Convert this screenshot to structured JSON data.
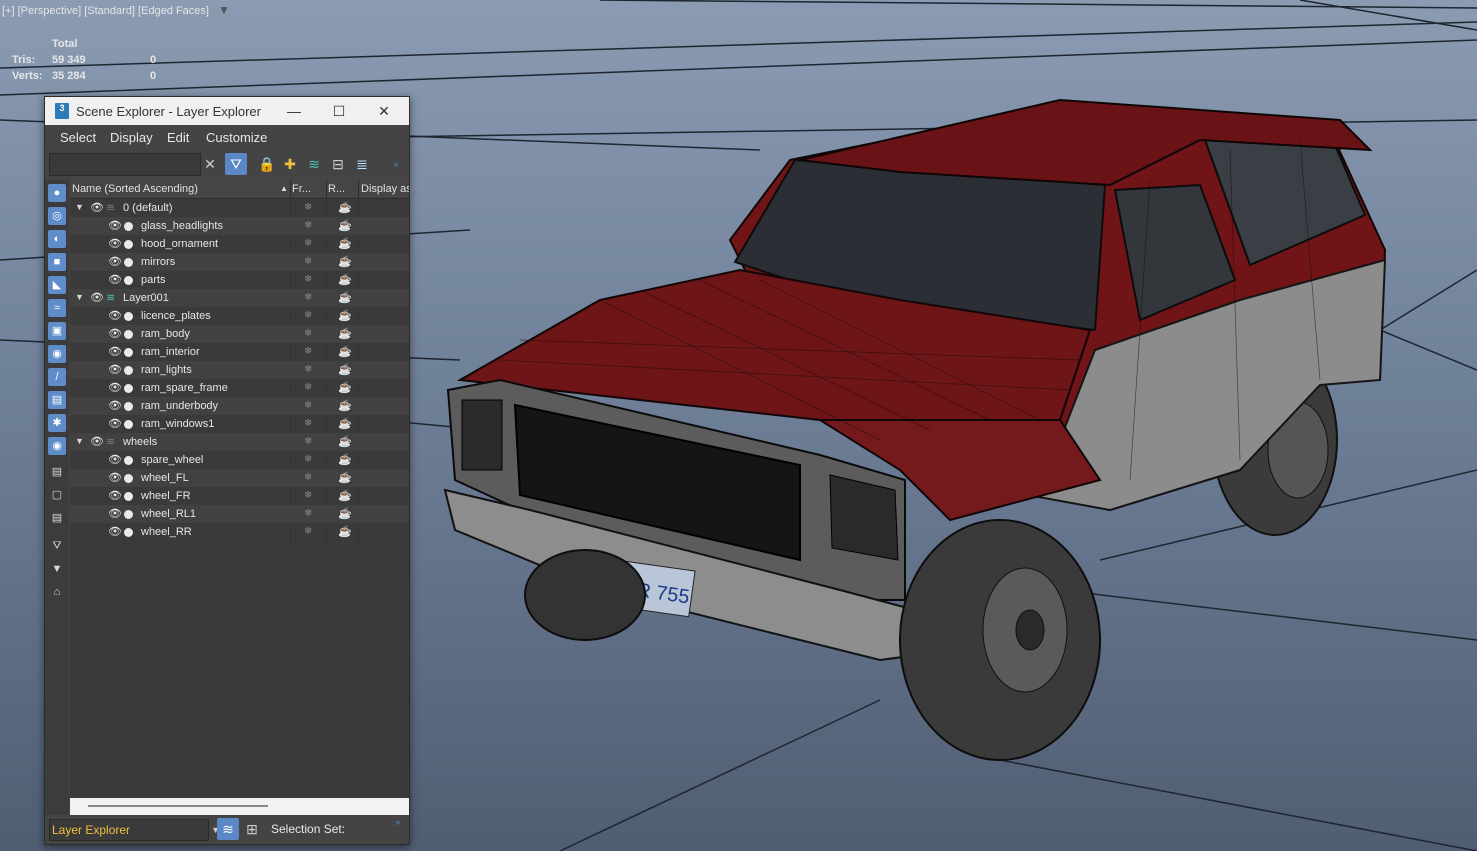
{
  "viewport": {
    "label": "[+] [Perspective] [Standard] [Edged Faces]",
    "filter_icon": "funnel-icon",
    "stats": {
      "header": "Total",
      "rows": [
        {
          "key": "Tris:",
          "total": "59 349",
          "selected": "0"
        },
        {
          "key": "Verts:",
          "total": "35 284",
          "selected": "0"
        }
      ]
    },
    "plate_text": "YYR 755",
    "colors": {
      "body_red": "#6b1416",
      "body_grey": "#8b8b8b",
      "tire": "#3a3a3a",
      "grid": "#1f2730"
    }
  },
  "explorer": {
    "title": "Scene Explorer - Layer Explorer",
    "app_icon": "3ds-max-icon",
    "menu": [
      "Select",
      "Display",
      "Edit",
      "Customize"
    ],
    "search_placeholder": "",
    "toolbar_icons": [
      "clear-icon",
      "filter-select-icon",
      "lock-icon",
      "new-layer-icon",
      "layer-stack-icon",
      "hierarchy-icon",
      "layers-icon"
    ],
    "columns": [
      "Name (Sorted Ascending)",
      "Fr...",
      "R...",
      "Display as"
    ],
    "rows": [
      {
        "level": 0,
        "name": "0 (default)",
        "expanded": true,
        "layer_icon": "layer-icon"
      },
      {
        "level": 1,
        "name": "glass_headlights"
      },
      {
        "level": 1,
        "name": "hood_ornament"
      },
      {
        "level": 1,
        "name": "mirrors"
      },
      {
        "level": 1,
        "name": "parts"
      },
      {
        "level": 0,
        "name": "Layer001",
        "expanded": true,
        "layer_icon": "active-layer-icon"
      },
      {
        "level": 1,
        "name": "licence_plates"
      },
      {
        "level": 1,
        "name": "ram_body"
      },
      {
        "level": 1,
        "name": "ram_interior"
      },
      {
        "level": 1,
        "name": "ram_lights"
      },
      {
        "level": 1,
        "name": "ram_spare_frame"
      },
      {
        "level": 1,
        "name": "ram_underbody"
      },
      {
        "level": 1,
        "name": "ram_windows1"
      },
      {
        "level": 0,
        "name": "wheels",
        "expanded": true,
        "layer_icon": "layer-icon"
      },
      {
        "level": 1,
        "name": "spare_wheel"
      },
      {
        "level": 1,
        "name": "wheel_FL"
      },
      {
        "level": 1,
        "name": "wheel_FR"
      },
      {
        "level": 1,
        "name": "wheel_RL1"
      },
      {
        "level": 1,
        "name": "wheel_RR"
      }
    ],
    "explorer_type": "Layer Explorer",
    "selection_set_label": "Selection Set:"
  }
}
